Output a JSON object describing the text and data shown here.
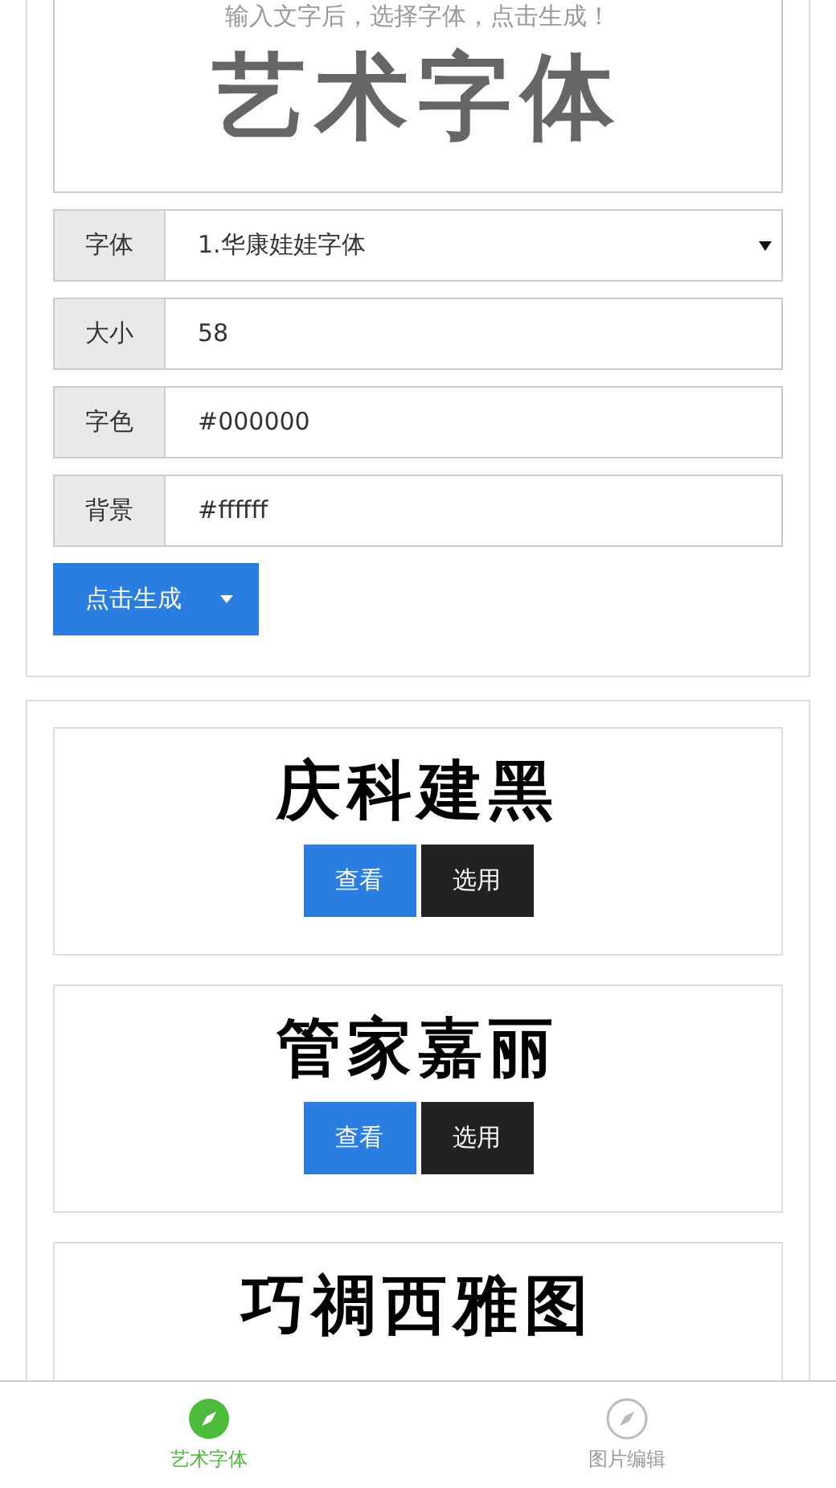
{
  "preview": {
    "hint": "输入文字后，选择字体，点击生成！",
    "text": "艺术字体"
  },
  "fields": [
    {
      "label": "字体",
      "kind": "select",
      "value": "1.华康娃娃字体"
    },
    {
      "label": "大小",
      "kind": "input",
      "value": "58"
    },
    {
      "label": "字色",
      "kind": "input",
      "value": "#000000"
    },
    {
      "label": "背景",
      "kind": "input",
      "value": "#ffffff"
    }
  ],
  "generate_button": "点击生成",
  "fonts": [
    {
      "sample": "庆科建黑",
      "view": "查看",
      "use": "选用"
    },
    {
      "sample": "管家嘉丽",
      "view": "查看",
      "use": "选用"
    },
    {
      "sample": "巧禂西雅图"
    }
  ],
  "nav": [
    {
      "label": "艺术字体",
      "selected": true
    },
    {
      "label": "图片编辑",
      "selected": false
    }
  ]
}
